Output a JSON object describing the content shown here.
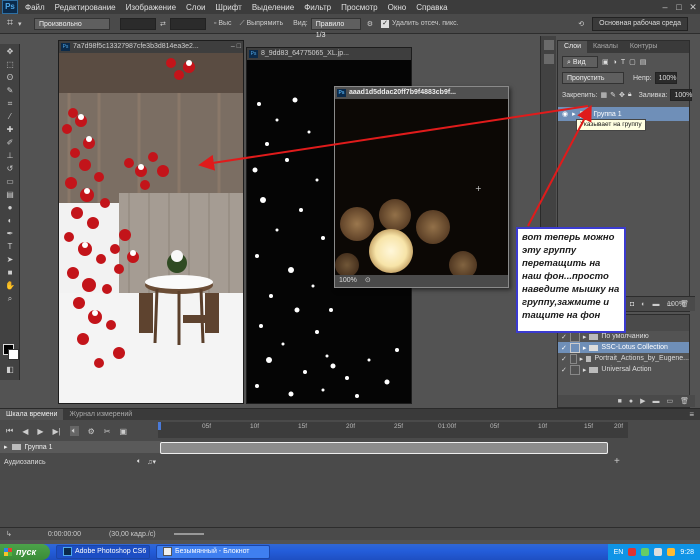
{
  "menu": {
    "logo": "Ps",
    "items": [
      "Файл",
      "Редактирование",
      "Изображение",
      "Слои",
      "Шрифт",
      "Выделение",
      "Фильтр",
      "Просмотр",
      "Окно",
      "Справка"
    ]
  },
  "options": {
    "style_value": "Произвольно",
    "swap": "⇄",
    "size_label": "Выс",
    "straighten": "Выпрямить",
    "view_label": "Вид:",
    "view_value": "Правило 1/3",
    "delete_label": "Удалить отсеч. пикс.",
    "workspace": "Основная рабочая среда"
  },
  "documents": [
    {
      "title": "7a7d98f5c13327987cfe3b3d814ea3e2..."
    },
    {
      "title": "8_9dd83_64775065_XL.jp..."
    },
    {
      "title": "aaad1d5ddac20ff7b9f4883cb9f...",
      "zoom": "100%"
    }
  ],
  "layers_panel": {
    "tabs": [
      "Слои",
      "Каналы",
      "Контуры"
    ],
    "search_label": "Вид",
    "blend_mode": "Пропустить",
    "opacity_label": "Непр:",
    "opacity_value": "100%",
    "lock_label": "Закрепить:",
    "fill_label": "Заливка:",
    "fill_value": "100%",
    "layer_name": "Группа 1",
    "tooltip": "Указывает на группу",
    "fx_label": "fx"
  },
  "actions_panel": {
    "zoom": "100%",
    "rows": [
      "По умолчанию",
      "SSC-Lotus Collection",
      "Portrait_Actions_by_Eugene...",
      "Universal Action"
    ]
  },
  "timeline": {
    "tabs": [
      "Шкала времени",
      "Журнал измерений"
    ],
    "ticks": [
      "05f",
      "10f",
      "15f",
      "20f",
      "25f",
      "01:00f",
      "05f",
      "10f",
      "15f",
      "20f"
    ],
    "track_name": "Группа 1",
    "audio_label": "Аудиозапись",
    "timecode": "0:00:00:00",
    "fps": "(30,00 кадр./с)"
  },
  "callout": {
    "text": "вот теперь можно эту группу перетащить на наш фон...просто наведите мышку на группу,зажмите и тащите на фон"
  },
  "taskbar": {
    "start": "пуск",
    "tasks": [
      "Adobe Photoshop CS6",
      "Безымянный - Блокнот"
    ],
    "lang": "EN",
    "clock": "9:28"
  },
  "colors": {
    "app_bg": "#535353",
    "annotation_red": "#e01b1b",
    "callout_border": "#3b3bd0",
    "xp_taskbar": "#245edb",
    "start_green": "#3a8b38"
  }
}
